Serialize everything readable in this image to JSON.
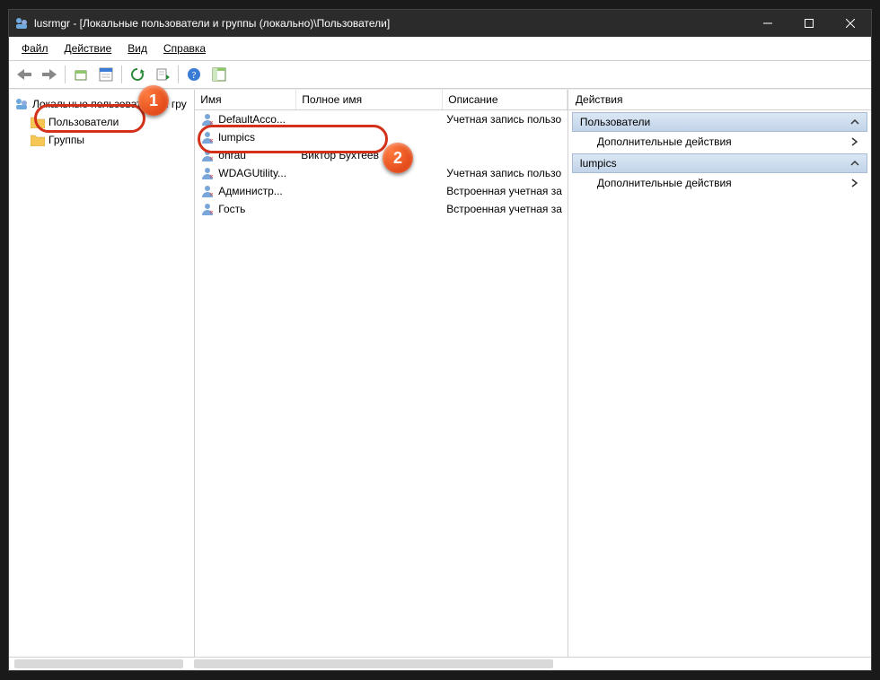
{
  "title": "lusrmgr - [Локальные пользователи и группы (локально)\\Пользователи]",
  "menu": {
    "file": "Файл",
    "action": "Действие",
    "view": "Вид",
    "help": "Справка"
  },
  "tree": {
    "root": "Локальные пользователи и гру",
    "users": "Пользователи",
    "groups": "Группы"
  },
  "columns": {
    "name": "Имя",
    "fullname": "Полное имя",
    "desc": "Описание"
  },
  "col_w": {
    "name": 100,
    "fullname": 150,
    "desc": 156
  },
  "rows": [
    {
      "name": "DefaultAcco...",
      "full": "",
      "desc": "Учетная запись пользо"
    },
    {
      "name": "lumpics",
      "full": "",
      "desc": ""
    },
    {
      "name": "ohrau",
      "full": "Виктор Бухтеев",
      "desc": ""
    },
    {
      "name": "WDAGUtility...",
      "full": "",
      "desc": "Учетная запись пользо"
    },
    {
      "name": "Администр...",
      "full": "",
      "desc": "Встроенная учетная за"
    },
    {
      "name": "Гость",
      "full": "",
      "desc": "Встроенная учетная за"
    }
  ],
  "actions": {
    "header": "Действия",
    "group1": "Пользователи",
    "more": "Дополнительные действия",
    "group2": "lumpics"
  },
  "badges": {
    "one": "1",
    "two": "2"
  }
}
